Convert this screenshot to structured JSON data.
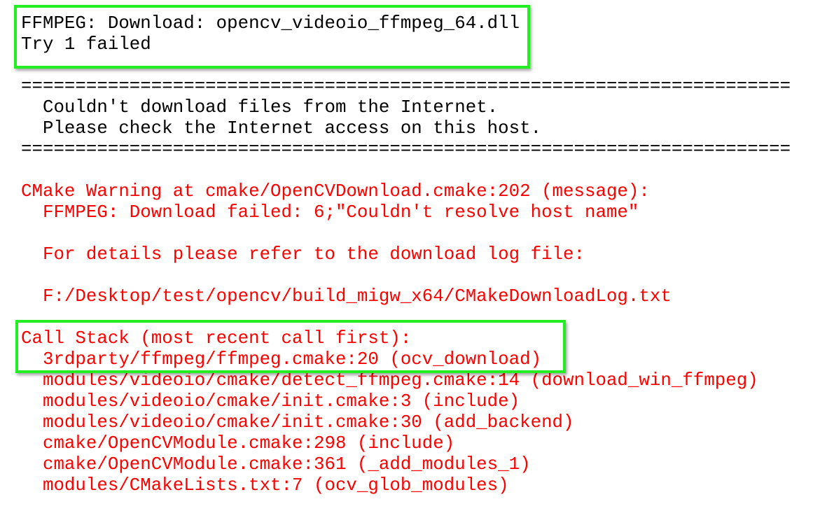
{
  "colors": {
    "normal_text": "#000000",
    "error_text": "#ff0000",
    "highlight_box": "#22ee22"
  },
  "lines": [
    {
      "text": "FFMPEG: Download: opencv_videoio_ffmpeg_64.dll",
      "style": "black"
    },
    {
      "text": "Try 1 failed",
      "style": "black"
    },
    {
      "text": "",
      "style": "black"
    },
    {
      "text": "=======================================================================",
      "style": "black"
    },
    {
      "text": "  Couldn't download files from the Internet.",
      "style": "black"
    },
    {
      "text": "  Please check the Internet access on this host.",
      "style": "black"
    },
    {
      "text": "=======================================================================",
      "style": "black"
    },
    {
      "text": "",
      "style": "black"
    },
    {
      "text": "CMake Warning at cmake/OpenCVDownload.cmake:202 (message):",
      "style": "red"
    },
    {
      "text": "  FFMPEG: Download failed: 6;\"Couldn't resolve host name\"",
      "style": "red"
    },
    {
      "text": "",
      "style": "red"
    },
    {
      "text": "  For details please refer to the download log file:",
      "style": "red"
    },
    {
      "text": "",
      "style": "red"
    },
    {
      "text": "  F:/Desktop/test/opencv/build_migw_x64/CMakeDownloadLog.txt",
      "style": "red"
    },
    {
      "text": "",
      "style": "red"
    },
    {
      "text": "Call Stack (most recent call first):",
      "style": "red"
    },
    {
      "text": "  3rdparty/ffmpeg/ffmpeg.cmake:20 (ocv_download)",
      "style": "red"
    },
    {
      "text": "  modules/videoio/cmake/detect_ffmpeg.cmake:14 (download_win_ffmpeg)",
      "style": "red"
    },
    {
      "text": "  modules/videoio/cmake/init.cmake:3 (include)",
      "style": "red"
    },
    {
      "text": "  modules/videoio/cmake/init.cmake:30 (add_backend)",
      "style": "red"
    },
    {
      "text": "  cmake/OpenCVModule.cmake:298 (include)",
      "style": "red"
    },
    {
      "text": "  cmake/OpenCVModule.cmake:361 (_add_modules_1)",
      "style": "red"
    },
    {
      "text": "  modules/CMakeLists.txt:7 (ocv_glob_modules)",
      "style": "red"
    }
  ]
}
